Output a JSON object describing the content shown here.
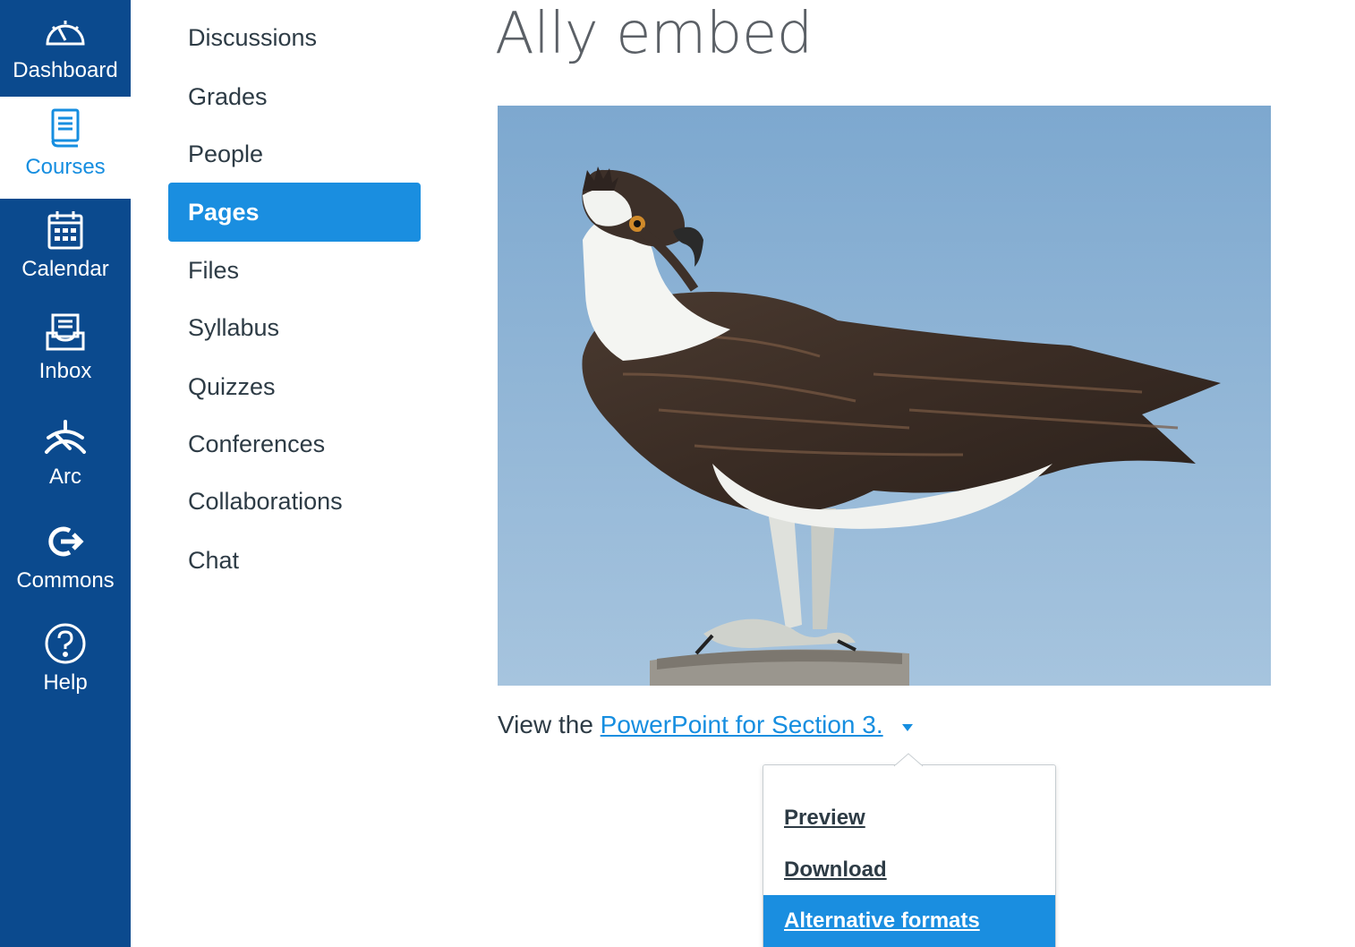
{
  "global_nav": {
    "items": [
      {
        "label": "Dashboard",
        "icon": "dashboard-icon"
      },
      {
        "label": "Courses",
        "icon": "courses-icon",
        "active": true
      },
      {
        "label": "Calendar",
        "icon": "calendar-icon"
      },
      {
        "label": "Inbox",
        "icon": "inbox-icon"
      },
      {
        "label": "Arc",
        "icon": "arc-icon"
      },
      {
        "label": "Commons",
        "icon": "commons-icon"
      },
      {
        "label": "Help",
        "icon": "help-icon"
      }
    ]
  },
  "course_nav": {
    "items": [
      {
        "label": "Discussions"
      },
      {
        "label": "Grades"
      },
      {
        "label": "People"
      },
      {
        "label": "Pages",
        "active": true
      },
      {
        "label": "Files"
      },
      {
        "label": "Syllabus"
      },
      {
        "label": "Quizzes"
      },
      {
        "label": "Conferences"
      },
      {
        "label": "Collaborations"
      },
      {
        "label": "Chat"
      }
    ]
  },
  "content": {
    "title": "Ally embed",
    "image_subject": "osprey perched on a wooden post",
    "view_prefix": "View the ",
    "link_text": "PowerPoint for Section 3. ",
    "caret_icon": "caret-down-icon"
  },
  "dropdown": {
    "items": [
      {
        "label": "Preview"
      },
      {
        "label": "Download"
      },
      {
        "label": "Alternative formats",
        "highlighted": true
      }
    ]
  },
  "colors": {
    "nav_bg": "#0b4a8e",
    "accent": "#1a8ee0",
    "link": "#168ee0",
    "text": "#2d3b45"
  }
}
